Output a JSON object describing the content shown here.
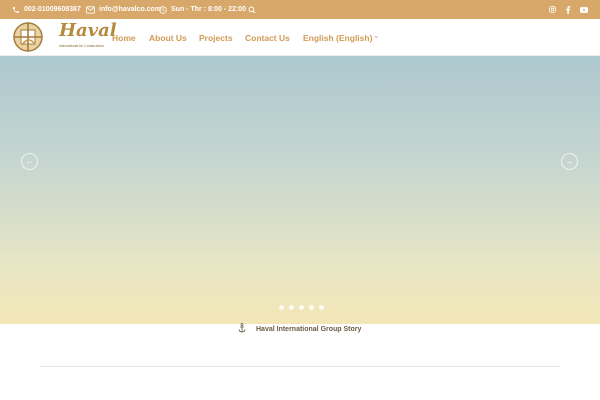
{
  "topbar": {
    "phone": "002-01009608387",
    "email": "info@havalco.com",
    "hours": "Sun - Thr : 8:00 - 22:00",
    "icons": [
      "phone-icon",
      "mail-icon",
      "clock-icon",
      "search-icon",
      "instagram-icon",
      "facebook-icon",
      "youtube-icon"
    ]
  },
  "logo": {
    "name": "Haval",
    "tagline": "International for Construction"
  },
  "nav": {
    "home": "Home",
    "about": "About Us",
    "projects": "Projects",
    "contact": "Contact Us",
    "language": "English (English)",
    "language_caret": "⌄"
  },
  "hero": {
    "prev_glyph": "←",
    "next_glyph": "→",
    "slide_count": 5
  },
  "story": {
    "title": "Haval International Group Story"
  },
  "colors": {
    "topbar_bg": "#d8a76a",
    "accent": "#d19a55",
    "logo_gold": "#b58a3c"
  }
}
